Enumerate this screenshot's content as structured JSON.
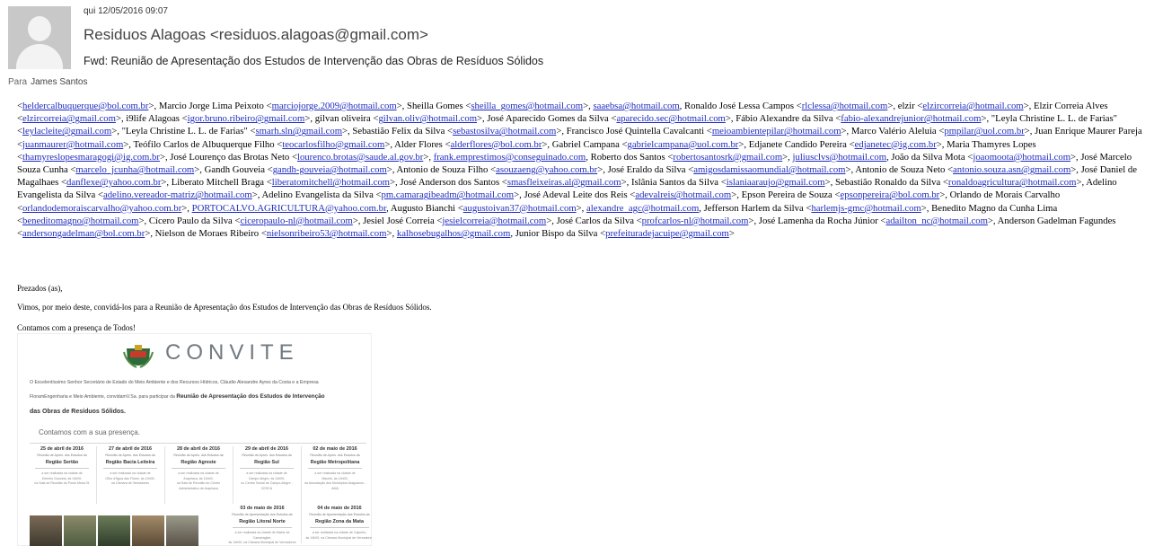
{
  "header": {
    "date": "qui 12/05/2016 09:07",
    "sender": "Residuos Alagoas <residuos.alagoas@gmail.com>",
    "subject": "Fwd: Reunião de Apresentação dos Estudos de Intervenção das Obras de Resíduos Sólidos",
    "to_label": "Para",
    "to_name": "James Santos"
  },
  "recipients_segments": [
    {
      "t": "<"
    },
    {
      "l": "heldercalbuquerque@bol.com.br"
    },
    {
      "t": ">, Marcio Jorge Lima Peixoto <"
    },
    {
      "l": "marciojorge.2009@hotmail.com"
    },
    {
      "t": ">, Sheilla Gomes <"
    },
    {
      "l": "sheilla_gomes@hotmail.com"
    },
    {
      "t": ">, "
    },
    {
      "l": "saaebsa@hotmail.com"
    },
    {
      "t": ", Ronaldo José Lessa Campos <"
    },
    {
      "l": "rlclessa@hotmail.com"
    },
    {
      "t": ">, elzir <"
    },
    {
      "l": "elzircorreia@hotmail.com"
    },
    {
      "t": ">, Elzir Correia Alves <"
    },
    {
      "l": "elzircorreia@gmail.com"
    },
    {
      "t": ">, i9life Alagoas <"
    },
    {
      "l": "igor.bruno.ribeiro@gmail.com"
    },
    {
      "t": ">, gilvan oliveira <"
    },
    {
      "l": "gilvan.oliv@hotmail.com"
    },
    {
      "t": ">, José Aparecido Gomes da Silva <"
    },
    {
      "l": "aparecido.sec@hotmail.com"
    },
    {
      "t": ">, Fábio Alexandre da Silva <"
    },
    {
      "l": "fabio-alexandrejunior@hotmail.com"
    },
    {
      "t": ">, \"Leyla Christine L. L. de Farias\" <"
    },
    {
      "l": "leylacleite@gmail.com"
    },
    {
      "t": ">, \"Leyla Christine L. L. de Farias\" <"
    },
    {
      "l": "smarh.sln@gmail.com"
    },
    {
      "t": ">, Sebastião Felix da Silva <"
    },
    {
      "l": "sebastosilva@hotmail.com"
    },
    {
      "t": ">, Francisco José Quintella Cavalcanti <"
    },
    {
      "l": "meioambientepilar@hotmail.com"
    },
    {
      "t": ">, Marco Valério Aleluia <"
    },
    {
      "l": "pmpilar@uol.com.br"
    },
    {
      "t": ">, Juan Enrique Maurer Pareja <"
    },
    {
      "l": "juanmaurer@hotmail.com"
    },
    {
      "t": ">, Teófilo Carlos de Albuquerque Filho <"
    },
    {
      "l": "teocarlosfilho@gmail.com"
    },
    {
      "t": ">, Alder Flores <"
    },
    {
      "l": "alderflores@bol.com.br"
    },
    {
      "t": ">, Gabriel Campana <"
    },
    {
      "l": "gabrielcampana@uol.com.br"
    },
    {
      "t": ">, Edjanete Candido Pereira <"
    },
    {
      "l": "edjanetec@ig.com.br"
    },
    {
      "t": ">, Maria Thamyres Lopes <"
    },
    {
      "l": "thamyreslopesmaragogi@ig.com.br"
    },
    {
      "t": ">, José Lourenço das Brotas Neto <"
    },
    {
      "l": "lourenco.brotas@saude.al.gov.br"
    },
    {
      "t": ">, "
    },
    {
      "l": "frank.emprestimos@conseguinado.com"
    },
    {
      "t": ", Roberto dos Santos <"
    },
    {
      "l": "robertosantosrk@gmail.com"
    },
    {
      "t": ">, "
    },
    {
      "l": "juliusclvs@hotmail.com"
    },
    {
      "t": ", João da Silva Mota <"
    },
    {
      "l": "joaomoota@hotmail.com"
    },
    {
      "t": ">, José Marcelo Souza Cunha <"
    },
    {
      "l": "marcelo_jcunha@hotmail.com"
    },
    {
      "t": ">, Gandh Gouveia <"
    },
    {
      "l": "gandh-gouveia@hotmail.com"
    },
    {
      "t": ">, Antonio de Souza Filho <"
    },
    {
      "l": "asouzaeng@yahoo.com.br"
    },
    {
      "t": ">, José Eraldo da Silva <"
    },
    {
      "l": "amigosdamissaomundial@hotmail.com"
    },
    {
      "t": ">, Antonio de Souza Neto <"
    },
    {
      "l": "antonio.souza.asn@gmail.com"
    },
    {
      "t": ">, José Daniel de Magalhaes <"
    },
    {
      "l": "danflexe@yahoo.com.br"
    },
    {
      "t": ">, Liberato Mitchell Braga <"
    },
    {
      "l": "liberatomitchell@hotmail.com"
    },
    {
      "t": ">, José Anderson dos Santos <"
    },
    {
      "l": "smasfleixeiras.al@gmail.com"
    },
    {
      "t": ">, Islânia Santos da Silva <"
    },
    {
      "l": "islaniaaraujo@gmail.com"
    },
    {
      "t": ">, Sebastião Ronaldo da Silva <"
    },
    {
      "l": "ronaldoagricultura@hotmail.com"
    },
    {
      "t": ">, Adelino Evangelista da Silva <"
    },
    {
      "l": "adelino.vereador-matriz@hotmail.com"
    },
    {
      "t": ">, Adelino Evangelista da Silva <"
    },
    {
      "l": "pm.camaragibeadm@hotmail.com"
    },
    {
      "t": ">, José Adeval Leite dos Reis <"
    },
    {
      "l": "adevalreis@hotmail.com"
    },
    {
      "t": ">, Epson Pereira de Souza <"
    },
    {
      "l": "epsonpereira@bol.com.br"
    },
    {
      "t": ">, Orlando de Morais Carvalho <"
    },
    {
      "l": "orlandodemoraiscarvalho@yahoo.com.br"
    },
    {
      "t": ">, "
    },
    {
      "l": "PORTOCALVO.AGRICULTURA@yahoo.com.br"
    },
    {
      "t": ", Augusto Bianchi <"
    },
    {
      "l": "augustoivan37@hotmail.com"
    },
    {
      "t": ">, "
    },
    {
      "l": "alexandre_agc@hotmail.com"
    },
    {
      "t": ", Jefferson Harlem da Silva <"
    },
    {
      "l": "harlemjs-gmc@hotmail.com"
    },
    {
      "t": ">, Benedito Magno da Cunha Lima <"
    },
    {
      "l": "beneditomagno@hotmail.com"
    },
    {
      "t": ">, Cícero Paulo da Silva <"
    },
    {
      "l": "ciceropaulo-nl@hotmail.com"
    },
    {
      "t": ">, Jesiel José Correia <"
    },
    {
      "l": "jesielcorreia@hotmail.com"
    },
    {
      "t": ">, José Carlos da Silva <"
    },
    {
      "l": "profcarlos-nl@hotmail.com"
    },
    {
      "t": ">, José Lamenha da Rocha Júnior <"
    },
    {
      "l": "adailton_nc@hotmail.com"
    },
    {
      "t": ">, Anderson Gadelman Fagundes <"
    },
    {
      "l": "andersongadelman@bol.com.br"
    },
    {
      "t": ">, Nielson de Moraes Ribeiro <"
    },
    {
      "l": "nielsonribeiro53@hotmail.com"
    },
    {
      "t": ">, "
    },
    {
      "l": "kalhosebugalhos@gmail.com"
    },
    {
      "t": ", Junior Bispo da Silva <"
    },
    {
      "l": "prefeituradejacuipe@gmail.com"
    },
    {
      "t": ">"
    }
  ],
  "body": {
    "greeting": "Prezados (as),",
    "line1": "Vimos, por meio deste, convidá-los para a Reunião de Apresentação dos Estudos de Intervenção das Obras de Resíduos Sólidos.",
    "line2": "Contamos com a presença de Todos!"
  },
  "invite": {
    "title": "CONVITE",
    "para1": "O Excelentíssimo Senhor Secretário de Estado do Meio Ambiente e dos Recursos Hídricos, Cláudio Alexandre Ayres da Costa e a Empresa",
    "para2_prefix": "FloramEngenharia e Meio Ambiente, convidamV.Sa. para participar da",
    "para2_bold": "Reunião de Apresentação dos Estudos de Intervenção",
    "bold_line": "das Obras de Resíduos Sólidos.",
    "presence": "Contamos com a sua presença.",
    "sessions_top": [
      {
        "date": "25 de abril de 2016",
        "sub": "Reunião de Apres. dos Estudos da",
        "region": "Região Sertão",
        "extra": [
          "a ser realizada na cidade de",
          "Delmiro Gouveia, às 14h00,",
          "na Sala de Reunião do Posto Mesa 01"
        ]
      },
      {
        "date": "27 de abril de 2016",
        "sub": "Reunião de Apres. dos Estudos da",
        "region": "Região Bacia Leiteira",
        "extra": [
          "a ser realizada na cidade de",
          "Olho d'Água das Flores, às 14h00,",
          "na Câmara de Vereadores"
        ]
      },
      {
        "date": "28 de abril de 2016",
        "sub": "Reunião de Apres. dos Estudos da",
        "region": "Região Agreste",
        "extra": [
          "a ser realizada na cidade de",
          "Arapiraca, às 14h00,",
          "na Sala de Reunião do Centro",
          "Administrativo de Arapiraca"
        ]
      },
      {
        "date": "29 de abril de 2016",
        "sub": "Reunião de Apres. dos Estudos da",
        "region": "Região Sul",
        "extra": [
          "a ser realizada na cidade de",
          "Campo Alegre, às 14h00,",
          "no Centro Social de Campo Alegre -",
          "CESCA"
        ]
      },
      {
        "date": "02 de maio de 2016",
        "sub": "Reunião de Apres. dos Estudos da",
        "region": "Região Metropolitana",
        "extra": [
          "a ser realizada na cidade de",
          "Maceió, às 14h00,",
          "na Associação dos Municípios Alagoanos -",
          "AMA"
        ]
      }
    ],
    "sessions_bottom": [
      {
        "date": "03 de maio de 2016",
        "sub": "Reunião de Apresentação dos Estudos da",
        "region": "Região Litoral Norte",
        "extra": [
          "a ser realizada na cidade de Matriz de Camaragibe,",
          "às 14h00, na Câmara Municipal de Vereadores"
        ]
      },
      {
        "date": "04 de maio de 2016",
        "sub": "Reunião de Apresentação dos Estudos da",
        "region": "Região Zona da Mata",
        "extra": [
          "a ser realizada na cidade de Cajueiro,",
          "às 14h00, na Câmara Municipal de Vereadores"
        ]
      }
    ]
  }
}
